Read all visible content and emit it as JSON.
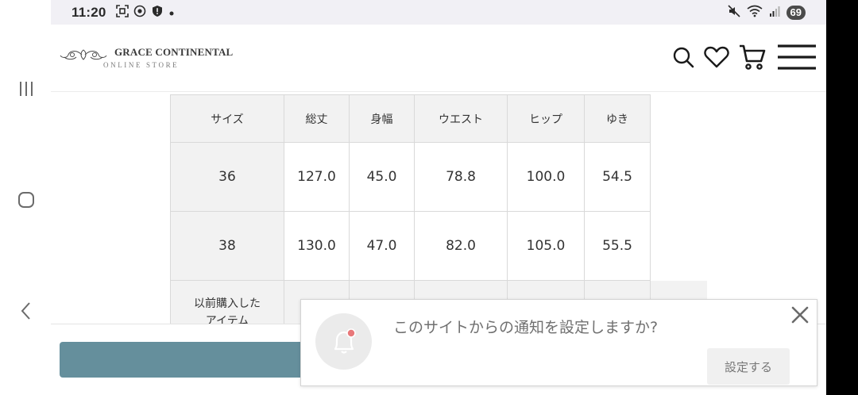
{
  "status_bar": {
    "time": "11:20",
    "battery": "69"
  },
  "header": {
    "brand": "GRACE CONTINENTAL",
    "brand_sub": "ONLINE STORE"
  },
  "size_table": {
    "headers": [
      "サイズ",
      "総丈",
      "身幅",
      "ウエスト",
      "ヒップ",
      "ゆき"
    ],
    "rows": [
      [
        "36",
        "127.0",
        "45.0",
        "78.8",
        "100.0",
        "54.5"
      ],
      [
        "38",
        "130.0",
        "47.0",
        "82.0",
        "105.0",
        "55.5"
      ]
    ],
    "partial_row_label": "以前購入した\nアイテム"
  },
  "notification": {
    "message": "このサイトからの通知を設定しますか?",
    "button_label": "設定する"
  },
  "colors": {
    "accent_teal": "#658f9c",
    "notification_dot": "#e8787a"
  }
}
